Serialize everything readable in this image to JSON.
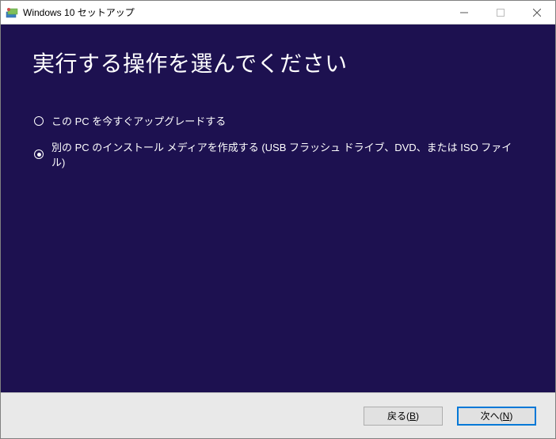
{
  "window": {
    "title": "Windows 10 セットアップ"
  },
  "main": {
    "heading": "実行する操作を選んでください",
    "options": [
      {
        "label": "この PC を今すぐアップグレードする",
        "selected": false
      },
      {
        "label": "別の PC のインストール メディアを作成する (USB フラッシュ ドライブ、DVD、または ISO ファイル)",
        "selected": true
      }
    ]
  },
  "footer": {
    "back": {
      "prefix": "戻る(",
      "key": "B",
      "suffix": ")"
    },
    "next": {
      "prefix": "次へ(",
      "key": "N",
      "suffix": ")"
    }
  },
  "colors": {
    "content_bg": "#1d1150",
    "footer_bg": "#e9e9e9",
    "primary_border": "#0078d7"
  }
}
